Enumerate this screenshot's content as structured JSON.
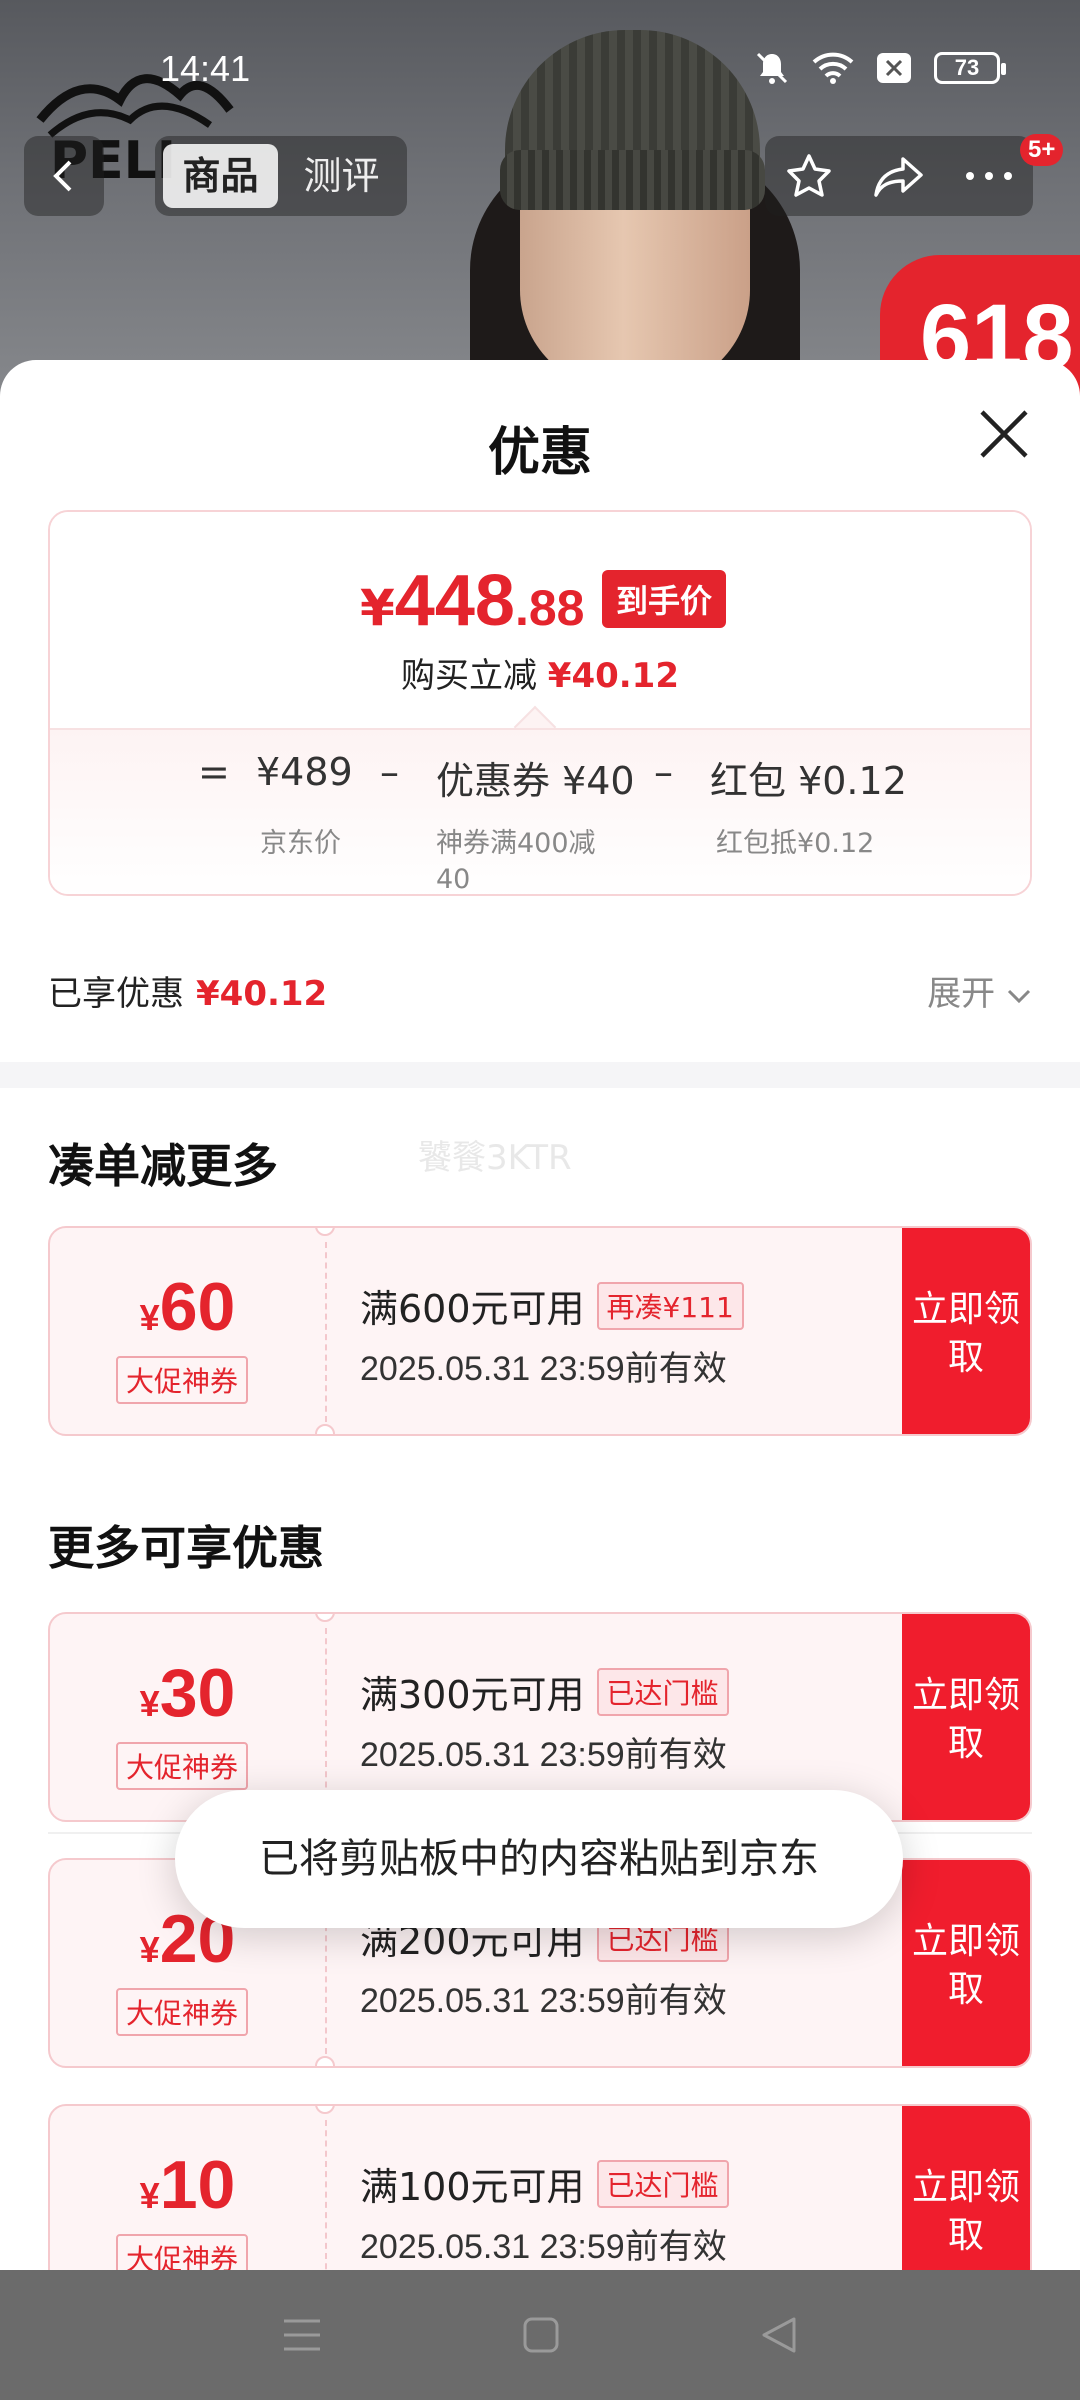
{
  "status": {
    "time": "14:41",
    "battery": "73"
  },
  "background": {
    "badge": "618",
    "brand_logo": "PELI"
  },
  "header": {
    "tabs": [
      "商品",
      "测评"
    ],
    "cart_count": "5+"
  },
  "sheet": {
    "title": "优惠",
    "price_box": {
      "currency": "¥",
      "price_int": "448",
      "price_dec": ".88",
      "final_tag": "到手价",
      "reduction_prefix": "购买立减",
      "reduction_value": "¥40.12",
      "equals": "=",
      "minus": "–",
      "base_price": "¥489",
      "base_label": "京东价",
      "coupon_term": "优惠券 ¥40",
      "coupon_label": "神券满400减40",
      "redpack_term": "红包 ¥0.12",
      "redpack_label": "红包抵¥0.12"
    },
    "enjoyed": {
      "label": "已享优惠",
      "value": "¥40.12",
      "expand": "展开"
    },
    "watermark": "饕餮3KTR",
    "section1_title": "凑单减更多",
    "section2_title": "更多可享优惠",
    "coupons": [
      {
        "currency": "¥",
        "amount": "60",
        "label": "大促神券",
        "condition": "满600元可用",
        "tag": "再凑¥111",
        "expiry": "2025.05.31 23:59前有效",
        "button": "立即领取"
      },
      {
        "currency": "¥",
        "amount": "30",
        "label": "大促神券",
        "condition": "满300元可用",
        "tag": "已达门槛",
        "expiry": "2025.05.31 23:59前有效",
        "button": "立即领取"
      },
      {
        "currency": "¥",
        "amount": "20",
        "label": "大促神券",
        "condition": "满200元可用",
        "tag": "已达门槛",
        "expiry": "2025.05.31 23:59前有效",
        "button": "立即领取"
      },
      {
        "currency": "¥",
        "amount": "10",
        "label": "大促神券",
        "condition": "满100元可用",
        "tag": "已达门槛",
        "expiry": "2025.05.31 23:59前有效",
        "button": "立即领取"
      }
    ]
  },
  "toast": "已将剪贴板中的内容粘贴到京东"
}
